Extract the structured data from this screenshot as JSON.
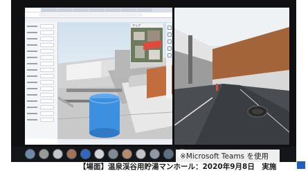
{
  "meeting": {
    "overlay_note": "※Microsoft Teams を使用",
    "caption": "【場面】温泉渓谷用貯湯マンホール：2020年9月8日　実施"
  },
  "shared_screen": {
    "browser_tabs": [
      "",
      "",
      "",
      "",
      "",
      "",
      "",
      ""
    ],
    "minimap_title": "マップ"
  },
  "colors": {
    "teams_bar": "#15161a",
    "panel": "#f4f5f7",
    "pipe_blue": "#3d8fe0",
    "fence_brown": "#a4643a",
    "caption_accent": "#1f5fbf"
  },
  "icons": {
    "left_toolbar": [
      "select-icon",
      "measure-icon",
      "section-icon",
      "walk-icon",
      "camera-icon"
    ],
    "participants": [
      "avatar-1",
      "avatar-2",
      "avatar-3",
      "avatar-4",
      "avatar-5",
      "avatar-6",
      "avatar-7",
      "avatar-8",
      "avatar-9",
      "avatar-10",
      "avatar-11",
      "avatar-12"
    ]
  }
}
